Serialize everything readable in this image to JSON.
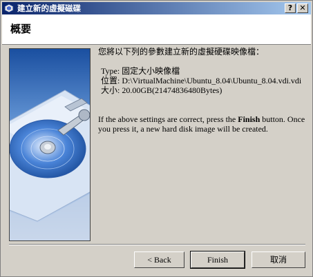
{
  "window": {
    "title": "建立新的虛擬磁碟"
  },
  "titlebar_buttons": {
    "help": "?",
    "close": "✕"
  },
  "header": {
    "title": "概要"
  },
  "summary": {
    "intro": "您將以下列的參數建立新的虛擬硬碟映像檔：",
    "type_line": "Type: 固定大小映像檔",
    "location_line": "位置: D:\\VirtualMachine\\Ubuntu_8.04\\Ubuntu_8.04.vdi.vdi",
    "size_line": "大小: 20.00GB(21474836480Bytes)",
    "note_line1_before": "If the above settings are correct, press the ",
    "note_line1_bold": "Finish",
    "note_line1_after": " button. Once",
    "note_line2": "you press it, a new hard disk image will be created."
  },
  "buttons": {
    "back": "< Back",
    "finish": "Finish",
    "cancel": "取消"
  },
  "colors": {
    "title_bar_start": "#0a246a",
    "title_bar_end": "#a6caf0",
    "face": "#d4d0c8"
  },
  "icons": [
    "virtualbox-icon",
    "hard-disk-illustration"
  ]
}
